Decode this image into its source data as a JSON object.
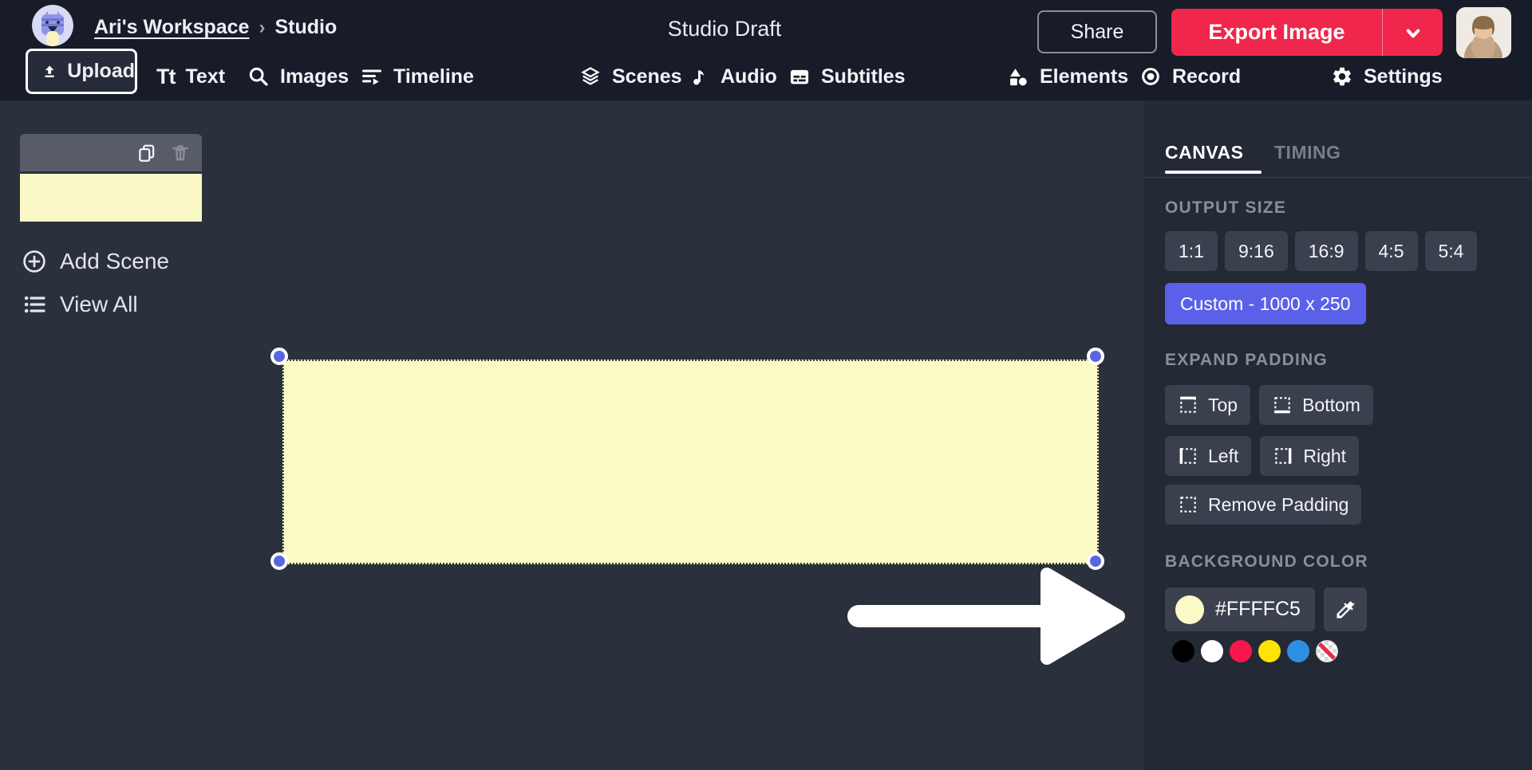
{
  "header": {
    "breadcrumb": {
      "workspace": "Ari's Workspace",
      "separator": "›",
      "page": "Studio"
    },
    "title": "Studio Draft",
    "share_label": "Share",
    "export_label": "Export Image",
    "toolbar": [
      {
        "id": "upload",
        "label": "Upload",
        "active": true
      },
      {
        "id": "text",
        "label": "Text",
        "icon_glyph": "Tt"
      },
      {
        "id": "images",
        "label": "Images"
      },
      {
        "id": "timeline",
        "label": "Timeline"
      },
      {
        "id": "scenes",
        "label": "Scenes"
      },
      {
        "id": "audio",
        "label": "Audio",
        "icon_glyph": "♪"
      },
      {
        "id": "subtitles",
        "label": "Subtitles"
      },
      {
        "id": "elements",
        "label": "Elements"
      },
      {
        "id": "record",
        "label": "Record"
      },
      {
        "id": "settings",
        "label": "Settings"
      }
    ]
  },
  "scenes_sidebar": {
    "add_scene_label": "Add Scene",
    "view_all_label": "View All",
    "thumbnail_color": "#FFFFC5"
  },
  "canvas": {
    "selected_rect_color": "#FFFFC5",
    "arrow_color": "#FFFFFF",
    "handle_color": "#5B66DE"
  },
  "right_panel": {
    "tabs": [
      {
        "label": "CANVAS",
        "active": true
      },
      {
        "label": "TIMING",
        "active": false
      }
    ],
    "output_size": {
      "label": "OUTPUT SIZE",
      "ratios": [
        "1:1",
        "9:16",
        "16:9",
        "4:5",
        "5:4"
      ],
      "custom_label": "Custom - 1000 x 250"
    },
    "expand_padding": {
      "label": "EXPAND PADDING",
      "top": "Top",
      "bottom": "Bottom",
      "left": "Left",
      "right": "Right",
      "remove": "Remove Padding"
    },
    "background_color": {
      "label": "BACKGROUND COLOR",
      "hex": "#FFFFC5",
      "swatches": [
        "#000000",
        "#FFFFFF",
        "#F8174B",
        "#FFE400",
        "#2D8FE2",
        "transparent"
      ]
    },
    "accent_color": "#5A61E8"
  },
  "brand": {
    "export_button_color": "#F0264D"
  }
}
